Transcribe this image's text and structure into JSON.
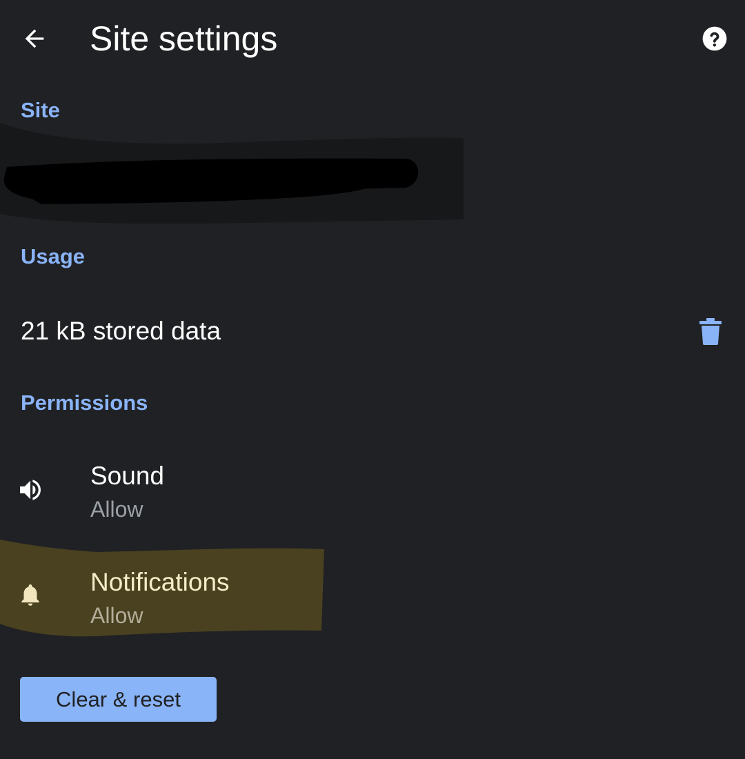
{
  "header": {
    "title": "Site settings",
    "back_icon": "arrow-left-icon",
    "help_icon": "help-circle-icon"
  },
  "sections": {
    "site_label": "Site",
    "usage_label": "Usage",
    "permissions_label": "Permissions"
  },
  "usage": {
    "stored_data": "21 kB stored data",
    "delete_icon": "trash-icon"
  },
  "permissions": [
    {
      "icon": "speaker-icon",
      "title": "Sound",
      "status": "Allow"
    },
    {
      "icon": "bell-icon",
      "title": "Notifications",
      "status": "Allow"
    }
  ],
  "actions": {
    "reset_label": "Clear & reset"
  },
  "colors": {
    "background": "#202124",
    "accent": "#8ab4f8",
    "highlight": "#4a4121",
    "redaction": "#000000",
    "primary_text": "#ffffff",
    "secondary_text": "#9aa0a6"
  }
}
